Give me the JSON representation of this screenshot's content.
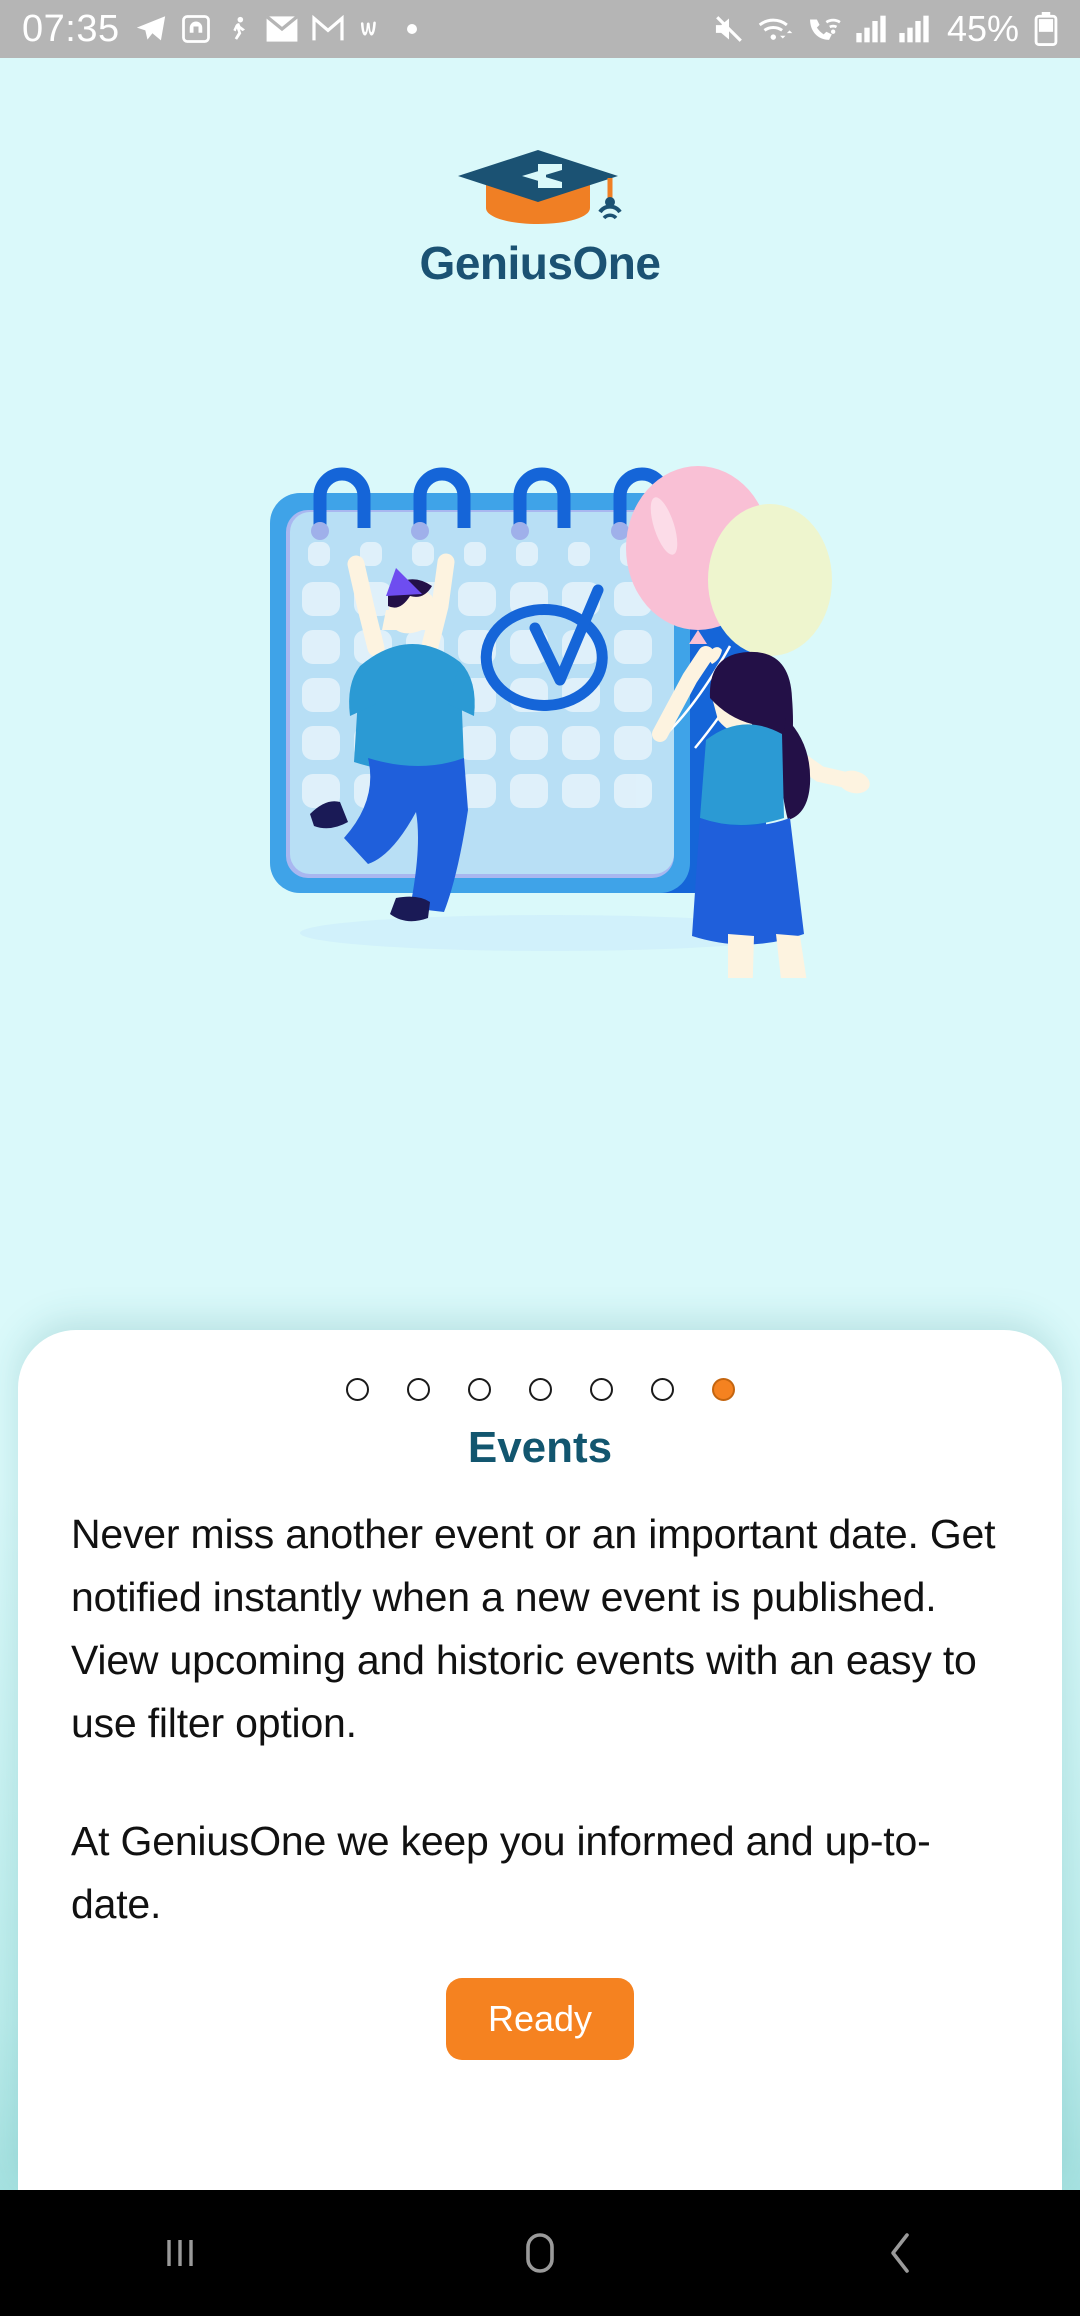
{
  "status_bar": {
    "clock": "07:35",
    "battery_percent": "45%",
    "left_icons": [
      "telegram-icon",
      "headphones-icon",
      "person-running-icon",
      "envelope-icon",
      "gmail-icon",
      "w-app-icon",
      "dot-icon"
    ],
    "right_icons": [
      "mute-icon",
      "wifi-data-icon",
      "wifi-calling-icon",
      "signal-bars-1-icon",
      "signal-bars-2-icon",
      "battery-icon"
    ]
  },
  "brand": {
    "name": "GeniusOne",
    "logo_icon": "graduation-cap-icon",
    "cap_color": "#1b5273",
    "accent_color": "#f58220"
  },
  "illustration": {
    "name": "calendar-event-illustration",
    "elements": [
      "calendar",
      "spiral-rings",
      "checkmark-circle",
      "man-celebrating",
      "woman-with-balloons",
      "pink-balloon",
      "yellow-balloon"
    ],
    "calendar_color": "#1565d8",
    "balloon_pink": "#f9c0d5",
    "balloon_yellow": "#eef5ce"
  },
  "onboarding": {
    "total_pages": 7,
    "active_page": 7,
    "title": "Events",
    "paragraph_1": "Never miss another event or an important date. Get notified instantly when a new event is published. View upcoming and historic events with an easy to use filter option.",
    "paragraph_2": "At GeniusOne we keep you informed and up-to-date.",
    "button_label": "Ready"
  },
  "nav_bar": {
    "recents_label": "recents-icon",
    "home_label": "home-icon",
    "back_label": "back-icon"
  }
}
